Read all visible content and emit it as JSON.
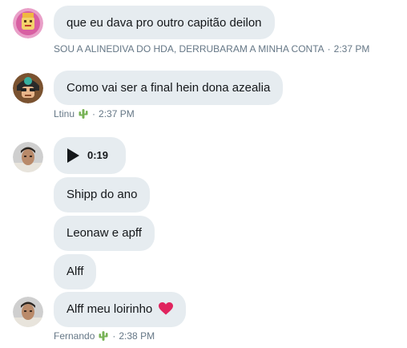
{
  "colors": {
    "bubble_bg": "#e6ecf0",
    "meta_text": "#657786",
    "heart": "#e0245e",
    "cactus": "#77b255"
  },
  "messages": [
    {
      "text": "que eu dava pro outro capitão deilon",
      "author": "SOU A ALINEDIVA DO HDA, DERRUBARAM A MINHA CONTA",
      "separator": "·",
      "time": "2:37 PM"
    },
    {
      "text": "Como vai ser a final hein dona azealia",
      "author": "Ltinu",
      "author_emoji": "cactus-icon",
      "separator": "·",
      "time": "2:37 PM"
    },
    {
      "audio_duration": "0:19"
    },
    {
      "text": "Shipp do ano"
    },
    {
      "text": "Leonaw e apff"
    },
    {
      "text": "Alff"
    },
    {
      "text": "Alff meu loirinho",
      "emoji": "heart-icon",
      "author": "Fernando",
      "author_emoji": "cactus-icon",
      "separator": "·",
      "time": "2:38 PM"
    }
  ]
}
